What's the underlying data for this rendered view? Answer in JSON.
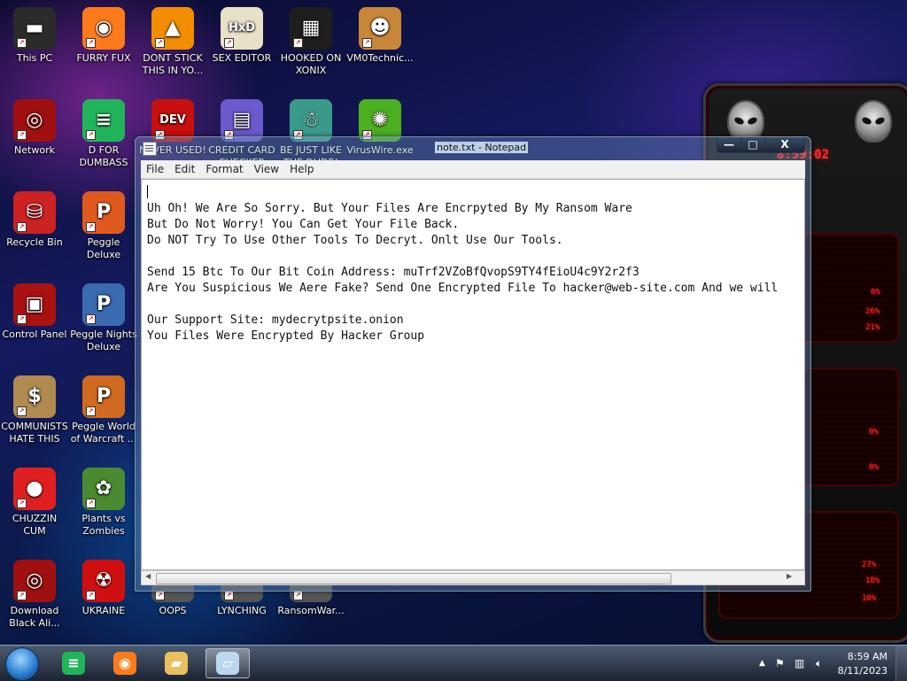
{
  "desktop": {
    "icons": [
      {
        "label": "This PC",
        "icon": "computer-icon",
        "color": "#2b2b2b",
        "glyph": "▬"
      },
      {
        "label": "FURRY FUX",
        "icon": "firefox-icon",
        "color": "#ff7a1a",
        "glyph": "◉"
      },
      {
        "label": "DONT STICK THIS IN YO...",
        "icon": "vlc-cone-icon",
        "color": "#f28c00",
        "glyph": "▲"
      },
      {
        "label": "SEX EDITOR",
        "icon": "hxd-hex-editor-icon",
        "color": "#e9e0c8",
        "glyph": "HxD"
      },
      {
        "label": "HOOKED ON XONIX",
        "icon": "xonix-game-icon",
        "color": "#1e1e1e",
        "glyph": "▦"
      },
      {
        "label": "VM0Technic...",
        "icon": "doctor-person-icon",
        "color": "#c8863a",
        "glyph": "☻"
      },
      {
        "label": "Network",
        "icon": "alien-network-icon",
        "color": "#a01010",
        "glyph": "◎"
      },
      {
        "label": "D FOR DUMBASS",
        "icon": "green-chat-icon",
        "color": "#22b45a",
        "glyph": "≡"
      },
      {
        "label": "NEVER USED!",
        "icon": "dev-cpp-icon",
        "color": "#c81010",
        "glyph": "DEV"
      },
      {
        "label": "CREDIT CARD CHECKER",
        "icon": "card-window-icon",
        "color": "#6a5acd",
        "glyph": "▤"
      },
      {
        "label": "BE JUST LIKE THE DUDE!",
        "icon": "santa-game-icon",
        "color": "#3a9a8a",
        "glyph": "☃"
      },
      {
        "label": "VirusWire.exe",
        "icon": "lime-wire-icon",
        "color": "#4caf20",
        "glyph": "✺"
      },
      {
        "label": "Recycle Bin",
        "icon": "recycle-bin-icon",
        "color": "#cc2222",
        "glyph": "⛁"
      },
      {
        "label": "Peggle Deluxe",
        "icon": "peggle-icon",
        "color": "#e05a20",
        "glyph": "P"
      },
      {
        "label": "Control Panel",
        "icon": "control-panel-icon",
        "color": "#aa1111",
        "glyph": "▣"
      },
      {
        "label": "Peggle Nights Deluxe",
        "icon": "peggle-nights-icon",
        "color": "#3a6ab0",
        "glyph": "P"
      },
      {
        "label": "COMMUNISTS HATE THIS G...",
        "icon": "money-bag-icon",
        "color": "#b08a50",
        "glyph": "$"
      },
      {
        "label": "Peggle World of Warcraft ...",
        "icon": "peggle-wow-icon",
        "color": "#d06a20",
        "glyph": "P"
      },
      {
        "label": "CHUZZIN CUM",
        "icon": "chuzzle-icon",
        "color": "#e02020",
        "glyph": "●"
      },
      {
        "label": "Plants vs Zombies",
        "icon": "plants-zombies-icon",
        "color": "#4a8a30",
        "glyph": "✿"
      },
      {
        "label": "Download Black Ali...",
        "icon": "alien-download-icon",
        "color": "#a01010",
        "glyph": "◎"
      },
      {
        "label": "UKRAINE",
        "icon": "radiation-icon",
        "color": "#d01010",
        "glyph": "☢"
      },
      {
        "label": "OOPS",
        "icon": "oops-icon",
        "color": "#555555",
        "glyph": ""
      },
      {
        "label": "LYNCHING",
        "icon": "lynching-icon",
        "color": "#555555",
        "glyph": ""
      },
      {
        "label": "RansomWar...",
        "icon": "ransomware-icon",
        "color": "#555555",
        "glyph": ""
      }
    ]
  },
  "notepad": {
    "title": "note.txt - Notepad",
    "menu": [
      "File",
      "Edit",
      "Format",
      "View",
      "Help"
    ],
    "lines": [
      "Uh Oh! We Are So Sorry. But Your Files Are Encrpyted By My Ransom Ware",
      "But Do Not Worry! You Can Get Your File Back.",
      "Do NOT Try To Use Other Tools To Decryt. Onlt Use Our Tools.",
      "",
      "Send 15 Btc To Our Bit Coin Address: muTrf2VZoBfQvopS9TY4fEioU4c9Y2r2f3",
      "Are You Suspicious We Aere Fake? Send One Encrypted File To hacker@web-site.com And we will",
      "",
      "Our Support Site: mydecrytpsite.onion",
      "You Files Were Encrypted By Hacker Group"
    ],
    "buttons": {
      "minimize": "—",
      "maximize": "□",
      "close": "X"
    }
  },
  "gadget": {
    "clock": "8:59:02",
    "stats": [
      "6%",
      "26%",
      "21%",
      "0%",
      "0%",
      "27%",
      "18%",
      "10%"
    ]
  },
  "taskbar": {
    "apps": [
      {
        "name": "green-chat-icon",
        "glyph": "≡",
        "color": "#22b45a"
      },
      {
        "name": "firefox-icon",
        "glyph": "◉",
        "color": "#ff7a1a"
      },
      {
        "name": "file-explorer-icon",
        "glyph": "▰",
        "color": "#e8c060"
      },
      {
        "name": "notepad-icon",
        "glyph": "▱",
        "color": "#bcd8f0"
      }
    ],
    "tray": {
      "time": "8:59 AM",
      "date": "8/11/2023"
    }
  },
  "colors": {
    "accent_red": "#ff2a2a",
    "taskbar": "#2a3446"
  }
}
